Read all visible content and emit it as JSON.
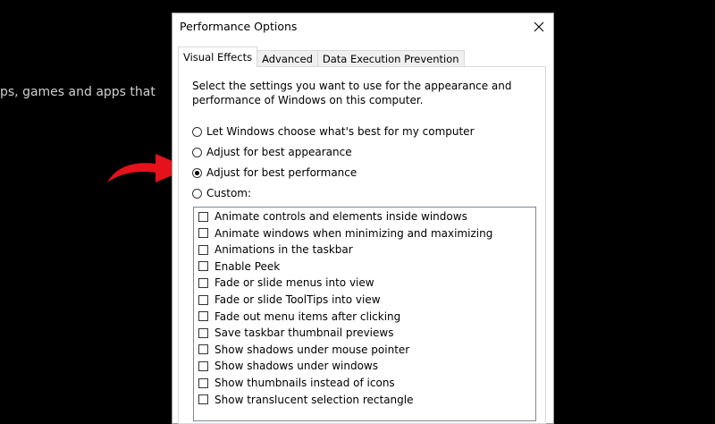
{
  "background": {
    "text": "ps, games and apps that"
  },
  "dialog": {
    "title": "Performance Options",
    "close_glyph": "✕",
    "tabs": [
      {
        "label": "Visual Effects",
        "active": true
      },
      {
        "label": "Advanced",
        "active": false
      },
      {
        "label": "Data Execution Prevention",
        "active": false
      }
    ],
    "description": "Select the settings you want to use for the appearance and performance of Windows on this computer.",
    "radios": [
      {
        "label": "Let Windows choose what's best for my computer",
        "selected": false
      },
      {
        "label": "Adjust for best appearance",
        "selected": false
      },
      {
        "label": "Adjust for best performance",
        "selected": true
      },
      {
        "label": "Custom:",
        "selected": false
      }
    ],
    "effects": [
      {
        "label": "Animate controls and elements inside windows",
        "checked": false
      },
      {
        "label": "Animate windows when minimizing and maximizing",
        "checked": false
      },
      {
        "label": "Animations in the taskbar",
        "checked": false
      },
      {
        "label": "Enable Peek",
        "checked": false
      },
      {
        "label": "Fade or slide menus into view",
        "checked": false
      },
      {
        "label": "Fade or slide ToolTips into view",
        "checked": false
      },
      {
        "label": "Fade out menu items after clicking",
        "checked": false
      },
      {
        "label": "Save taskbar thumbnail previews",
        "checked": false
      },
      {
        "label": "Show shadows under mouse pointer",
        "checked": false
      },
      {
        "label": "Show shadows under windows",
        "checked": false
      },
      {
        "label": "Show thumbnails instead of icons",
        "checked": false
      },
      {
        "label": "Show translucent selection rectangle",
        "checked": false
      }
    ]
  },
  "annotation": {
    "icon": "curved-arrow-icon",
    "color": "#e3121b"
  }
}
